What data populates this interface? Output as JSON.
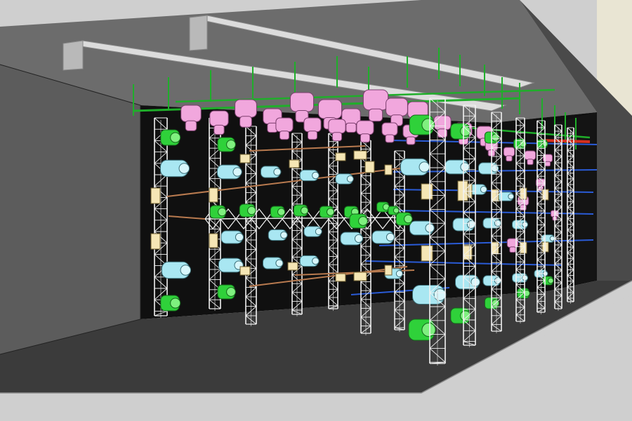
{
  "scene": {
    "colors": {
      "background": "#e9e5d3",
      "floor": "#3b3b3b",
      "back_wall": "#101010",
      "left_wall": "#5c5c5c",
      "right_wall": "#4a4a4a",
      "ceiling": "#6c6c6c",
      "wall_edge": "#cfcfcf",
      "beam": "#dcdcdc",
      "truss": "#f2f2f2",
      "pipe_green": "#1fae2a",
      "pipe_blue": "#2a5bd6",
      "pipe_red": "#d63020",
      "fixture_pink": "#f1a7dd",
      "fixture_cyan": "#a9e7f2",
      "fixture_green": "#2fd13a",
      "fixture_cream": "#f5e6b5",
      "rod": "#b87a4f"
    }
  }
}
